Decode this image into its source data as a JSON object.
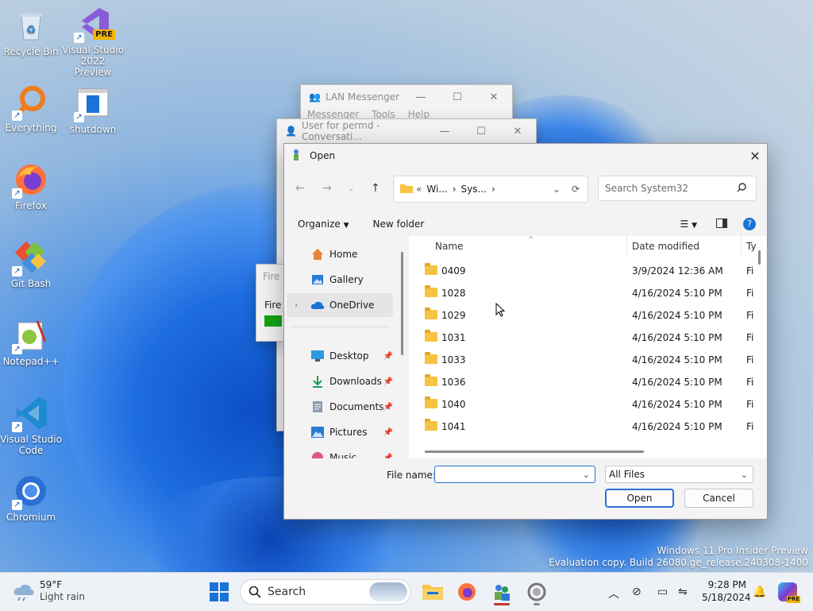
{
  "desktop_icons": [
    {
      "label": "Recycle Bin"
    },
    {
      "label": "Visual Studio 2022 Preview",
      "badge": "PRE"
    },
    {
      "label": "Everything"
    },
    {
      "label": "shutdown"
    },
    {
      "label": "Firefox"
    },
    {
      "label": "Git Bash"
    },
    {
      "label": "Notepad++"
    },
    {
      "label": "Visual Studio Code"
    },
    {
      "label": "Chromium"
    }
  ],
  "watermark": {
    "line1": "Windows 11 Pro Insider Preview",
    "line2": "Evaluation copy. Build 26080.ge_release.240308-1400"
  },
  "windows": {
    "lan": {
      "title": "LAN Messenger",
      "menu": [
        "Messenger",
        "Tools",
        "Help"
      ]
    },
    "conversation": {
      "title": "User for permd - Conversati..."
    },
    "fire_stub": {
      "title": "Fire",
      "text": "Fire"
    }
  },
  "dialog": {
    "title": "Open",
    "address": {
      "prefix": "«",
      "crumbs": [
        "Wi...",
        "Sys..."
      ]
    },
    "search_placeholder": "Search System32",
    "organize": "Organize",
    "new_folder": "New folder",
    "nav": [
      {
        "label": "Home",
        "icon": "home-icon"
      },
      {
        "label": "Gallery",
        "icon": "gallery-icon"
      },
      {
        "label": "OneDrive",
        "icon": "onedrive-icon",
        "selected": true
      },
      {
        "label": "Desktop",
        "icon": "desktop-icon",
        "pinned": true
      },
      {
        "label": "Downloads",
        "icon": "downloads-icon",
        "pinned": true
      },
      {
        "label": "Documents",
        "icon": "documents-icon",
        "pinned": true
      },
      {
        "label": "Pictures",
        "icon": "pictures-icon",
        "pinned": true
      },
      {
        "label": "Music",
        "icon": "music-icon",
        "pinned": true
      }
    ],
    "columns": {
      "name": "Name",
      "date": "Date modified",
      "type": "Ty"
    },
    "files": [
      {
        "name": "0409",
        "date": "3/9/2024 12:36 AM",
        "type": "Fi"
      },
      {
        "name": "1028",
        "date": "4/16/2024 5:10 PM",
        "type": "Fi"
      },
      {
        "name": "1029",
        "date": "4/16/2024 5:10 PM",
        "type": "Fi"
      },
      {
        "name": "1031",
        "date": "4/16/2024 5:10 PM",
        "type": "Fi"
      },
      {
        "name": "1033",
        "date": "4/16/2024 5:10 PM",
        "type": "Fi"
      },
      {
        "name": "1036",
        "date": "4/16/2024 5:10 PM",
        "type": "Fi"
      },
      {
        "name": "1040",
        "date": "4/16/2024 5:10 PM",
        "type": "Fi"
      },
      {
        "name": "1041",
        "date": "4/16/2024 5:10 PM",
        "type": "Fi"
      }
    ],
    "filename_label": "File name:",
    "filename_value": "",
    "filter": "All Files",
    "open_label": "Open",
    "cancel_label": "Cancel"
  },
  "taskbar": {
    "weather": {
      "temp": "59°F",
      "desc": "Light rain"
    },
    "search": "Search",
    "time": "9:28 PM",
    "date": "5/18/2024",
    "copilot_badge": "PRE"
  },
  "colors": {
    "accent": "#0067c0",
    "folder": "#f6c343",
    "selected_nav": "#e5e5e5"
  }
}
